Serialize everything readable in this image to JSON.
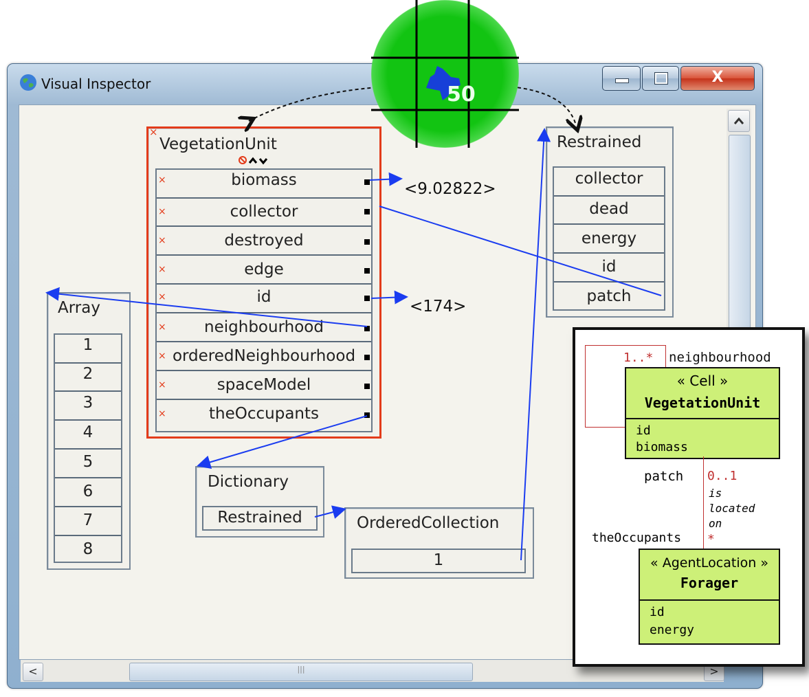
{
  "window": {
    "title": "Visual Inspector",
    "min_glyph": "▬",
    "max_glyph": "□",
    "close_glyph": "X"
  },
  "cell": {
    "label": "50"
  },
  "vegetation_unit": {
    "title": "VegetationUnit",
    "fields": [
      "biomass",
      "collector",
      "destroyed",
      "edge",
      "id",
      "neighbourhood",
      "orderedNeighbourhood",
      "spaceModel",
      "theOccupants"
    ],
    "biomass_value": "<9.02822>",
    "id_value": "<174>"
  },
  "restrained": {
    "title": "Restrained",
    "fields": [
      "collector",
      "dead",
      "energy",
      "id",
      "patch"
    ]
  },
  "array": {
    "title": "Array",
    "items": [
      "1",
      "2",
      "3",
      "4",
      "5",
      "6",
      "7",
      "8"
    ]
  },
  "dictionary": {
    "title": "Dictionary",
    "entry": "Restrained"
  },
  "ordered_collection": {
    "title": "OrderedCollection",
    "entry": "1"
  },
  "uml": {
    "neighbourhood_role": "neighbourhood",
    "neighbourhood_mult": "1..*",
    "cell_stereotype": "« Cell »",
    "cell_name": "VegetationUnit",
    "cell_attr1": "id",
    "cell_attr2": "biomass",
    "patch_role": "patch",
    "patch_mult": "0..1",
    "assoc_1": "is",
    "assoc_2": "located",
    "assoc_3": "on",
    "occupants_role": "theOccupants",
    "occupants_mult": "*",
    "agent_stereotype": "« AgentLocation »",
    "agent_name": "Forager",
    "agent_attr1": "id",
    "agent_attr2": "energy"
  },
  "scrollbars": {
    "left_arrow": "<",
    "right_arrow": ">",
    "up_arrow": "^",
    "grip": "|||"
  },
  "colors": {
    "selection": "#e33b1a",
    "link": "#1a3cf0",
    "uml_class": "#cdf078",
    "cell_green": "#12c412"
  }
}
